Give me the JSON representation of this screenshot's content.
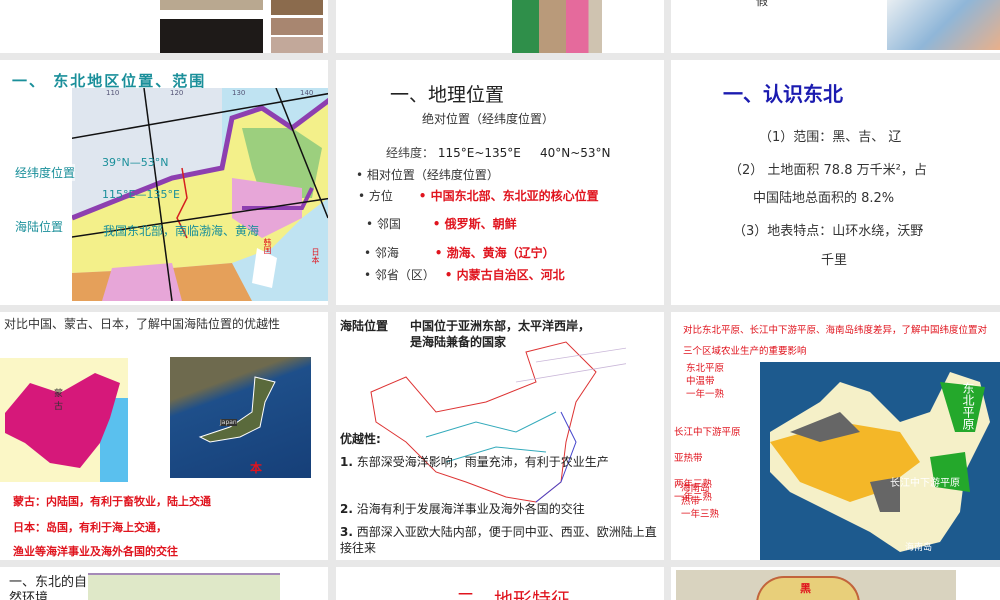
{
  "row1": {
    "s3_partial_text": "假"
  },
  "row2": {
    "slide1": {
      "title": "一、 东北地区位置、范围",
      "label_latlon": "经纬度位置",
      "label_sealand": "海陆位置",
      "lat": "39°N—53°N",
      "lon": "115°E—135°E",
      "sealand_text": "我国东北部，南临渤海、黄海",
      "lon_ticks": [
        "110",
        "120",
        "130",
        "140"
      ],
      "map_labels": [
        "韩国",
        "日本"
      ]
    },
    "slide2": {
      "title": "一、地理位置",
      "subtitle": "绝对位置（经纬度位置）",
      "latlon_label": "经纬度：",
      "lon": "115°E~135°E",
      "lat": "40°N~53°N",
      "bullets": [
        {
          "label": "相对位置（经纬度位置）",
          "value": ""
        },
        {
          "label": "方位",
          "value": "中国东北部、东北亚的核心位置"
        },
        {
          "label": "邻国",
          "value": "俄罗斯、朝鲜"
        },
        {
          "label": "邻海",
          "value": "渤海、黄海（辽宁）"
        },
        {
          "label": "邻省（区）",
          "value": "内蒙古自治区、河北"
        }
      ]
    },
    "slide3": {
      "title": "一、认识东北",
      "line1": "（1）范围：黑、吉、 辽",
      "line2": "（2） 土地面积 78.8 万千米²，占",
      "line2b": "中国陆地总面积的 8.2%",
      "line3": "（3）地表特点：山环水绕，沃野",
      "line3b": "千里"
    }
  },
  "row3": {
    "slide1": {
      "title": "对比中国、蒙古、日本，了解中国海陆位置的优越性",
      "map1_label": "蒙古",
      "map2_label": "Japan",
      "map2_char": "本",
      "notes": [
        "蒙古：内陆国，有利于畜牧业，陆上交通",
        "日本：岛国，有利于海上交通，",
        "渔业等海洋事业及海外各国的交往"
      ]
    },
    "slide2": {
      "heading": "海陆位置",
      "heading_text": "中国位于亚洲东部，太平洋西岸，",
      "heading_text2": "是海陆兼备的国家",
      "adv_title": "优越性:",
      "advantages": [
        {
          "num": "1.",
          "text": "东部深受海洋影响，雨量充沛，有利于农业生产"
        },
        {
          "num": "2.",
          "text": "沿海有利于发展海洋事业及海外各国的交往"
        },
        {
          "num": "3.",
          "text": "西部深入亚欧大陆内部，便于同中亚、西亚、欧洲陆上直接往来"
        }
      ]
    },
    "slide3": {
      "title": "对比东北平原、长江中下游平原、海南岛纬度差异，了解中国纬度位置对三个区域农业生产的重要影响",
      "regions": [
        {
          "name": "东北平原",
          "zone": "中温带",
          "crop": "一年一熟"
        },
        {
          "name": "长江中下游平原",
          "zone": "亚热带",
          "crop": "两年三熟\n一年二熟"
        },
        {
          "name": "海南岛",
          "zone": "热带",
          "crop": "一年三熟"
        }
      ],
      "map_labels": {
        "ne": "东北平原",
        "yangtze": "长江中下游平原",
        "hainan": "海南岛"
      }
    }
  },
  "row4": {
    "slide1_title": "一、东北的自然环境",
    "slide2_title": "二、地形特征",
    "slide3_map_label": "黑"
  },
  "colors": {
    "red": "#e0141e",
    "teal": "#1a8f9a",
    "blue": "#1b1bb0",
    "bg": "#e8e8e8"
  }
}
